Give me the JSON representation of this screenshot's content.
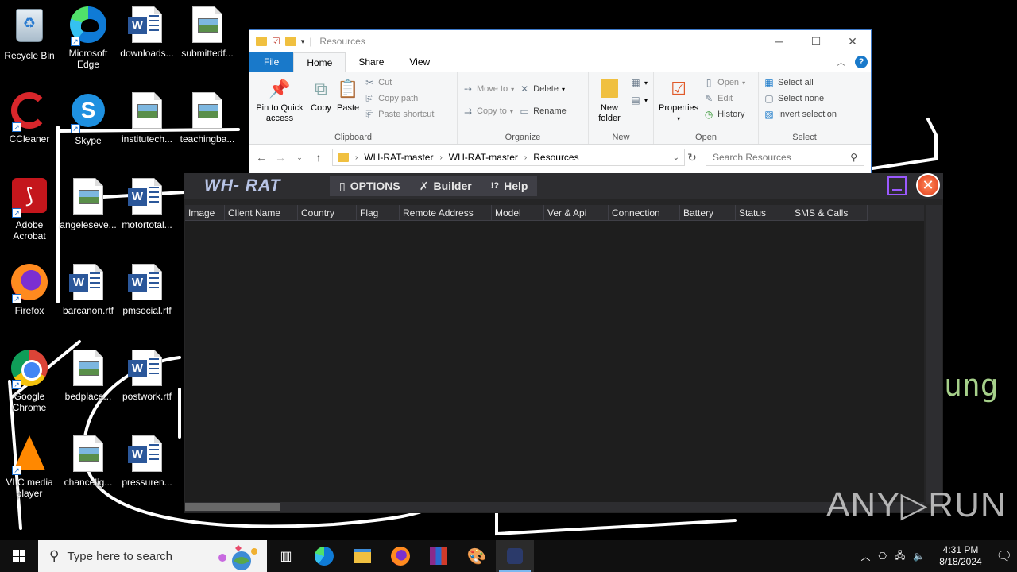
{
  "desktop": {
    "icons": [
      {
        "label": "Recycle Bin"
      },
      {
        "label": "Microsoft Edge"
      },
      {
        "label": "downloads..."
      },
      {
        "label": "submittedf..."
      },
      {
        "label": "CCleaner"
      },
      {
        "label": "Skype"
      },
      {
        "label": "institutech..."
      },
      {
        "label": "teachingba..."
      },
      {
        "label": "Adobe Acrobat"
      },
      {
        "label": "angeleseve..."
      },
      {
        "label": "motortotal..."
      },
      {
        "label": "Firefox"
      },
      {
        "label": "barcanon.rtf"
      },
      {
        "label": "pmsocial.rtf"
      },
      {
        "label": "Google Chrome"
      },
      {
        "label": "bedplace..."
      },
      {
        "label": "postwork.rtf"
      },
      {
        "label": "VLC media player"
      },
      {
        "label": "chancelig..."
      },
      {
        "label": "pressuren..."
      }
    ]
  },
  "explorer": {
    "title": "Resources",
    "tabs": {
      "file": "File",
      "home": "Home",
      "share": "Share",
      "view": "View"
    },
    "clipboard": {
      "pin": "Pin to Quick access",
      "copy": "Copy",
      "paste": "Paste",
      "cut": "Cut",
      "copy_path": "Copy path",
      "paste_shortcut": "Paste shortcut",
      "group": "Clipboard"
    },
    "organize": {
      "move_to": "Move to",
      "copy_to": "Copy to",
      "delete": "Delete",
      "rename": "Rename",
      "group": "Organize"
    },
    "new": {
      "new_folder": "New folder",
      "group": "New"
    },
    "open": {
      "properties": "Properties",
      "open": "Open",
      "edit": "Edit",
      "history": "History",
      "group": "Open"
    },
    "select": {
      "select_all": "Select all",
      "select_none": "Select none",
      "invert": "Invert selection",
      "group": "Select"
    },
    "breadcrumb": [
      "WH-RAT-master",
      "WH-RAT-master",
      "Resources"
    ],
    "search_placeholder": "Search Resources"
  },
  "whrat": {
    "logo": "WH- RAT",
    "menu": {
      "options": "OPTIONS",
      "builder": "Builder",
      "help": "Help"
    },
    "columns": [
      "Image",
      "Client Name",
      "Country",
      "Flag",
      "Remote Address",
      "Model",
      "Ver & Api",
      "Connection",
      "Battery",
      "Status",
      "SMS & Calls"
    ]
  },
  "watermark": {
    "partial_text": "ung",
    "brand": "ANY▷RUN"
  },
  "taskbar": {
    "search_placeholder": "Type here to search",
    "time": "4:31 PM",
    "date": "8/18/2024"
  }
}
